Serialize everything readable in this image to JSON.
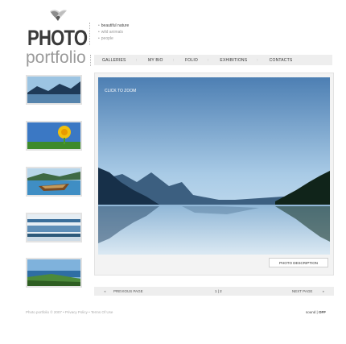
{
  "logo": {
    "title": "PHOTO",
    "subtitle": "portfolio"
  },
  "side_nav": [
    {
      "label": "beautiful nature",
      "active": true
    },
    {
      "label": "wild animals",
      "active": false
    },
    {
      "label": "people",
      "active": false
    }
  ],
  "top_nav": [
    {
      "label": "GALLERIES"
    },
    {
      "label": "MY BIO"
    },
    {
      "label": "FOLIO"
    },
    {
      "label": "EXHIBITIONS"
    },
    {
      "label": "CONTACTS"
    }
  ],
  "thumbnails": [
    {
      "name": "mountain-lake",
      "selected": true
    },
    {
      "name": "dandelion"
    },
    {
      "name": "boat-lake"
    },
    {
      "name": "snowy-shore"
    },
    {
      "name": "ocean-coast"
    }
  ],
  "main": {
    "zoom_label": "CLICK TO ZOOM",
    "description_label": "PHOTO DESCRIPTION"
  },
  "pager": {
    "prev_label": "PREVIOUS PAGE",
    "pages": "1 | 2",
    "next_label": "NEXT PAGE"
  },
  "footer": {
    "text": "Photo portfolio © 2007 • Privacy Policy • Terms Of Use",
    "sound_label": "sound",
    "sound_state": "OFF"
  },
  "colors": {
    "nav_bg": "#eeeeee",
    "sky_top": "#5f8fbe",
    "sky_bottom": "#cfe4f2",
    "logo_dark": "#3a3a3a",
    "logo_gray": "#9a9a9a"
  }
}
